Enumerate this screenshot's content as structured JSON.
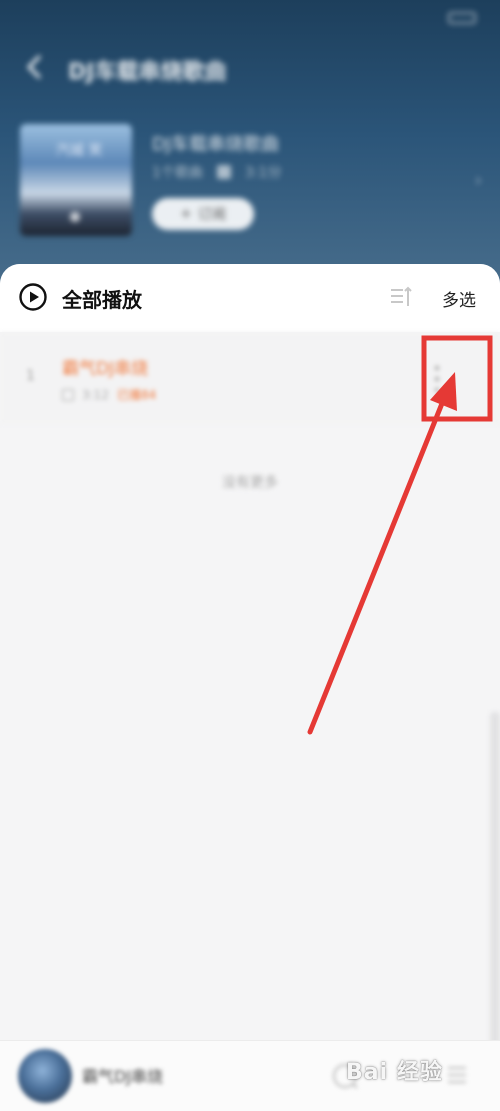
{
  "status_bar": {
    "left_text": "",
    "right_text": ""
  },
  "header": {
    "title": "DJ车载串烧歌曲",
    "album_title": "DJ车载串烧歌曲",
    "meta_play": "1个歌曲",
    "meta_duration": "3:1分",
    "subscribe_label": "订阅",
    "cover_text": "汽城 笑"
  },
  "toolbar": {
    "play_all_label": "全部播放",
    "multi_select_label": "多选"
  },
  "songs": [
    {
      "index": "1",
      "title": "霸气DJ串烧",
      "duration": "3:12",
      "tag": "已播84"
    }
  ],
  "list_end_text": "没有更多",
  "mini_player": {
    "title": "霸气DJ串烧"
  },
  "watermark": "Bai 经验",
  "colors": {
    "accent": "#f07a3e",
    "annotation_red": "#e53935",
    "header_top": "#1d3f5c",
    "header_bottom": "#4a6f8d"
  }
}
